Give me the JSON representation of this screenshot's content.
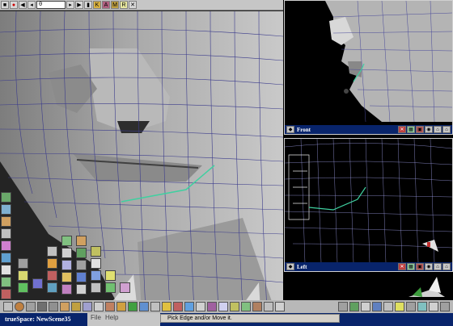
{
  "app": {
    "window_title": "trueSpace: NewScene35"
  },
  "toolbar": {
    "frame_value": "0",
    "buttons": [
      "stop-icon",
      "record-icon",
      "play-back-icon",
      "rewind-icon",
      "frame-field",
      "forward-icon",
      "play-icon",
      "end-icon",
      "key-icon",
      "anim-icon",
      "mat-icon",
      "render-icon",
      "tools-icon"
    ]
  },
  "viewports": {
    "front": {
      "title": "Front"
    },
    "left": {
      "title": "Left"
    }
  },
  "menu": {
    "file": "File",
    "help": "Help"
  },
  "status": {
    "hint": "Pick Edge and/or Move it."
  },
  "colors": {
    "viewport_bg": "#000000",
    "titlebar": "#08246b",
    "toolbar": "#c6c6c6",
    "mesh": "#a0a0a0",
    "wire": "#3b3b8f",
    "selection": "#3fd0a0"
  }
}
